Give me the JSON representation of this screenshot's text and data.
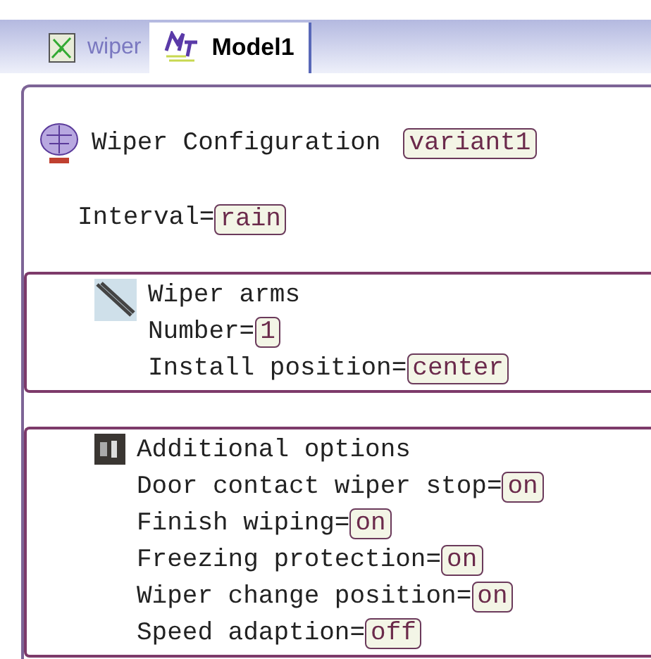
{
  "tabs": [
    {
      "label": "wiper",
      "selected": false,
      "kind": "diagram"
    },
    {
      "label": "Model1",
      "selected": true,
      "kind": "model"
    }
  ],
  "configuration": {
    "title": "Wiper Configuration",
    "value": "variant1",
    "interval": {
      "label": "Interval=",
      "value": "rain"
    }
  },
  "groups": [
    {
      "kind": "arms",
      "title": "Wiper arms",
      "properties": [
        {
          "label": "Number=",
          "value": "1"
        },
        {
          "label": "Install position=",
          "value": "center"
        }
      ]
    },
    {
      "kind": "options",
      "title": "Additional options",
      "properties": [
        {
          "label": "Door contact wiper stop=",
          "value": "on"
        },
        {
          "label": "Finish wiping=",
          "value": "on"
        },
        {
          "label": "Freezing protection=",
          "value": "on"
        },
        {
          "label": "Wiper change position=",
          "value": "on"
        },
        {
          "label": "Speed adaption=",
          "value": "off"
        }
      ]
    }
  ]
}
